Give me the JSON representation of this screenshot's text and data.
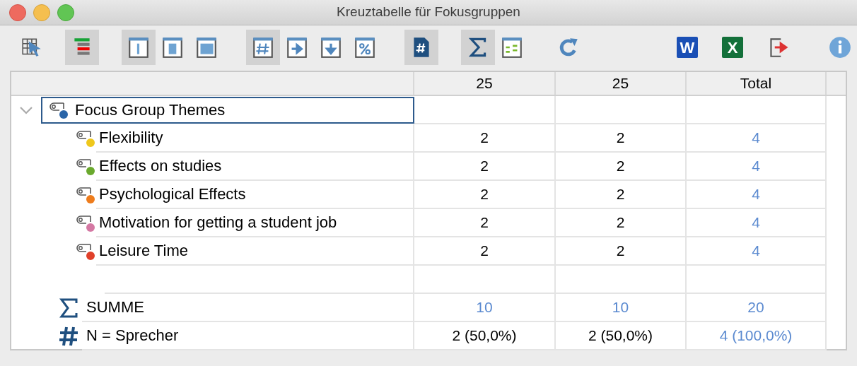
{
  "window": {
    "title": "Kreuztabelle für Fokusgruppen"
  },
  "toolbar": [
    {
      "selected": false
    },
    {
      "selected": true
    },
    {
      "selected": true
    },
    {
      "selected": false
    },
    {
      "selected": false
    },
    {
      "selected": true
    },
    {
      "selected": false
    },
    {
      "selected": false
    },
    {
      "selected": false
    },
    {
      "selected": true
    },
    {
      "selected": true
    },
    {
      "selected": false
    },
    {
      "selected": false
    },
    {
      "label": "W",
      "selected": false
    },
    {
      "label": "X",
      "selected": false
    },
    {
      "selected": false
    },
    {
      "selected": false
    }
  ],
  "table": {
    "columns": [
      "25",
      "25",
      "Total"
    ],
    "tree": {
      "label": "Focus Group Themes",
      "color": "#2a65a8",
      "expanded": true,
      "selected": true,
      "children": [
        {
          "label": "Flexibility",
          "color": "#efc81c",
          "values": [
            "2",
            "2",
            "4"
          ]
        },
        {
          "label": "Effects on studies",
          "color": "#6aa92e",
          "values": [
            "2",
            "2",
            "4"
          ]
        },
        {
          "label": "Psychological Effects",
          "color": "#ee7c1c",
          "values": [
            "2",
            "2",
            "4"
          ]
        },
        {
          "label": "Motivation for getting a student job",
          "color": "#d478a3",
          "values": [
            "2",
            "2",
            "4"
          ]
        },
        {
          "label": "Leisure Time",
          "color": "#e0402a",
          "values": [
            "2",
            "2",
            "4"
          ]
        }
      ]
    },
    "summary_rows": [
      {
        "kind": "sum",
        "label": "SUMME",
        "values": [
          "10",
          "10",
          "20"
        ]
      },
      {
        "kind": "count",
        "label": "N = Sprecher",
        "values": [
          "2 (50,0%)",
          "2 (50,0%)",
          "4 (100,0%)"
        ]
      }
    ]
  }
}
